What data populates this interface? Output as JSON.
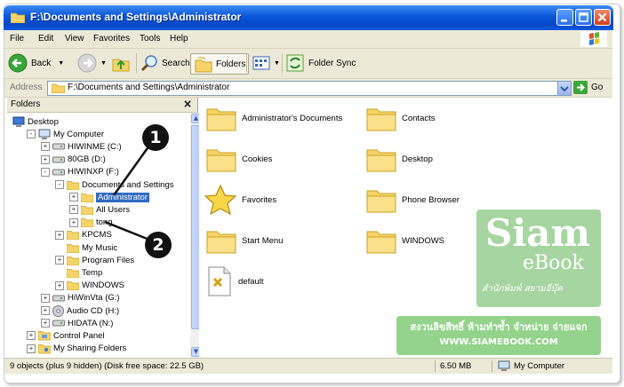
{
  "window": {
    "title": "F:\\Documents and Settings\\Administrator"
  },
  "menu": {
    "items": [
      "File",
      "Edit",
      "View",
      "Favorites",
      "Tools",
      "Help"
    ]
  },
  "toolbar": {
    "back_label": "Back",
    "search_label": "Search",
    "folders_label": "Folders",
    "folder_sync_label": "Folder Sync"
  },
  "address": {
    "label": "Address",
    "value": "F:\\Documents and Settings\\Administrator",
    "go_label": "Go"
  },
  "folders_pane": {
    "title": "Folders",
    "tree": [
      {
        "label": "Desktop",
        "expander": "",
        "icon": "desktop-icon"
      },
      {
        "label": "My Computer",
        "expander": "-",
        "icon": "computer-icon"
      },
      {
        "label": "HIWINME (C:)",
        "expander": "+",
        "icon": "drive-icon"
      },
      {
        "label": "80GB (D:)",
        "expander": "+",
        "icon": "drive-icon"
      },
      {
        "label": "HIWINXP (F:)",
        "expander": "-",
        "icon": "drive-icon"
      },
      {
        "label": "Documents and Settings",
        "expander": "-",
        "icon": "folder-icon"
      },
      {
        "label": "Administrator",
        "expander": "+",
        "icon": "folder-icon",
        "selected": true
      },
      {
        "label": "All Users",
        "expander": "+",
        "icon": "folder-icon"
      },
      {
        "label": "tong",
        "expander": "+",
        "icon": "folder-icon"
      },
      {
        "label": "KPCMS",
        "expander": "+",
        "icon": "folder-icon"
      },
      {
        "label": "My Music",
        "expander": "",
        "icon": "folder-icon"
      },
      {
        "label": "Program Files",
        "expander": "+",
        "icon": "folder-icon"
      },
      {
        "label": "Temp",
        "expander": "",
        "icon": "folder-icon"
      },
      {
        "label": "WINDOWS",
        "expander": "+",
        "icon": "folder-icon"
      },
      {
        "label": "HiWinVta (G:)",
        "expander": "+",
        "icon": "drive-icon"
      },
      {
        "label": "Audio CD (H:)",
        "expander": "+",
        "icon": "cd-icon"
      },
      {
        "label": "HIDATA (N:)",
        "expander": "+",
        "icon": "drive-icon"
      },
      {
        "label": "Control Panel",
        "expander": "+",
        "icon": "control-panel-icon"
      },
      {
        "label": "My Sharing Folders",
        "expander": "+",
        "icon": "sharing-folder-icon"
      }
    ]
  },
  "content_items": [
    {
      "label": "Administrator's Documents",
      "icon": "folder-icon"
    },
    {
      "label": "Contacts",
      "icon": "folder-icon"
    },
    {
      "label": "Cookies",
      "icon": "folder-icon"
    },
    {
      "label": "Desktop",
      "icon": "folder-icon"
    },
    {
      "label": "Favorites",
      "icon": "star-icon"
    },
    {
      "label": "Phone Browser",
      "icon": "folder-icon"
    },
    {
      "label": "Start Menu",
      "icon": "folder-icon"
    },
    {
      "label": "WINDOWS",
      "icon": "folder-icon"
    },
    {
      "label": "default",
      "icon": "file-icon"
    }
  ],
  "statusbar": {
    "summary": "9 objects (plus 9 hidden) (Disk free space: 22.5 GB)",
    "size": "6.50 MB",
    "location": "My Computer"
  },
  "callouts": [
    "1",
    "2"
  ],
  "watermark": {
    "brand": "Siam",
    "brand_sub": "eBook",
    "tagline": "สำนักพิมพ์ สยามอีบุ๊ค",
    "copyright": "สงวนลิขสิทธิ์ ห้ามทำซ้ำ จำหน่าย จ่ายแจก",
    "url": "WWW.SIAMEBOOK.COM"
  },
  "colors": {
    "titlebar": "#0a54d9",
    "selection": "#316ac5",
    "chrome": "#ece9d8",
    "folder": "#f6d46a"
  }
}
